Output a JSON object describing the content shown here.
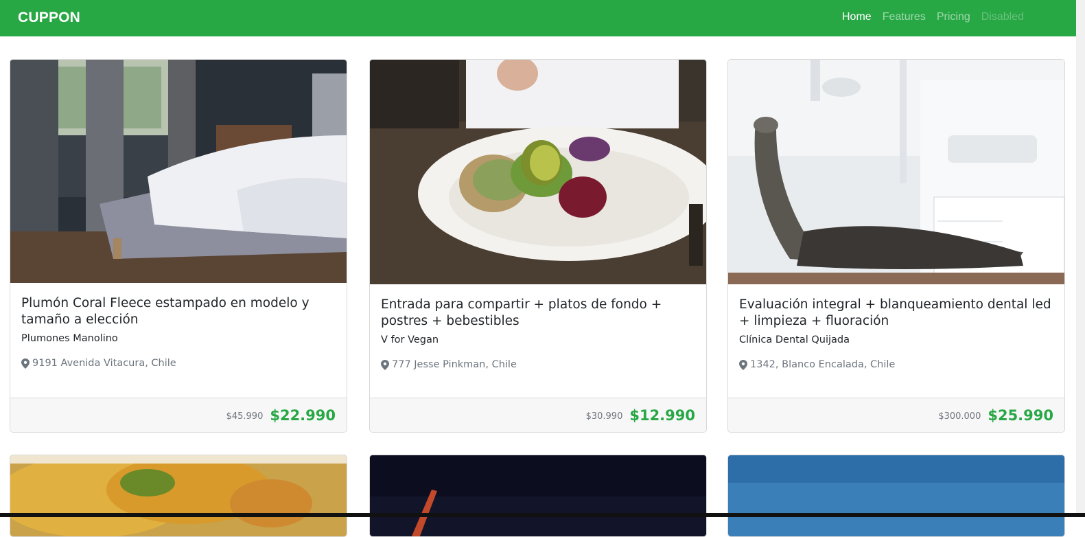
{
  "navbar": {
    "brand": "CUPPON",
    "links": [
      {
        "label": "Home"
      },
      {
        "label": "Features"
      },
      {
        "label": "Pricing"
      },
      {
        "label": "Disabled"
      }
    ]
  },
  "cards": [
    {
      "title": "Plumón Coral Fleece estampado en modelo y tamaño a elección",
      "merchant": "Plumones Manolino",
      "location": "9191 Avenida Vitacura, Chile",
      "old_price": "$45.990",
      "price": "$22.990"
    },
    {
      "title": "Entrada para compartir + platos de fondo + postres + bebestibles",
      "merchant": "V for Vegan",
      "location": "777 Jesse Pinkman, Chile",
      "old_price": "$30.990",
      "price": "$12.990"
    },
    {
      "title": "Evaluación integral + blanqueamiento dental led + limpieza + fluoración",
      "merchant": "Clínica Dental Quijada",
      "location": "1342, Blanco Encalada, Chile",
      "old_price": "$300.000",
      "price": "$25.990"
    }
  ],
  "colors": {
    "brand_green": "#28a745",
    "muted_text": "#6c757d"
  },
  "icons": [
    "map-marker-icon"
  ]
}
